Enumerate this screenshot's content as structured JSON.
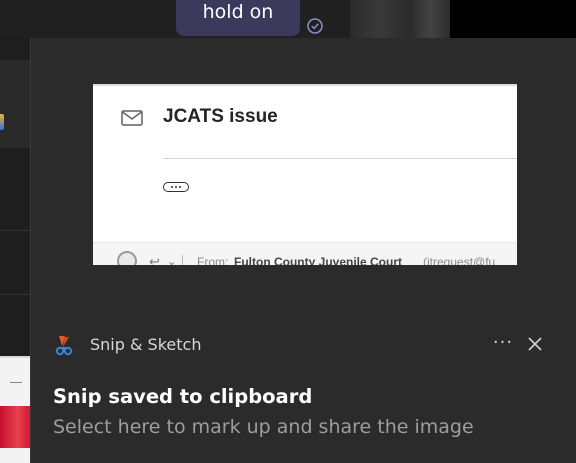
{
  "background": {
    "chat_bubble_text": "hold on",
    "check_icon": "check-circle-icon"
  },
  "toast": {
    "app_name": "Snip & Sketch",
    "app_icon": "snip-sketch-icon",
    "more_label": "···",
    "title": "Snip saved to clipboard",
    "body": "Select here to mark up and share the image",
    "preview": {
      "subject": "JCATS issue",
      "from_label": "From:",
      "from_name": "Fulton County Juvenile Court",
      "from_email": "(itrequest@fu"
    }
  },
  "colors": {
    "toast_bg": "#2b2b2b",
    "chat_bubble": "#3b3a5c",
    "accent_check": "#8a8fd8"
  }
}
